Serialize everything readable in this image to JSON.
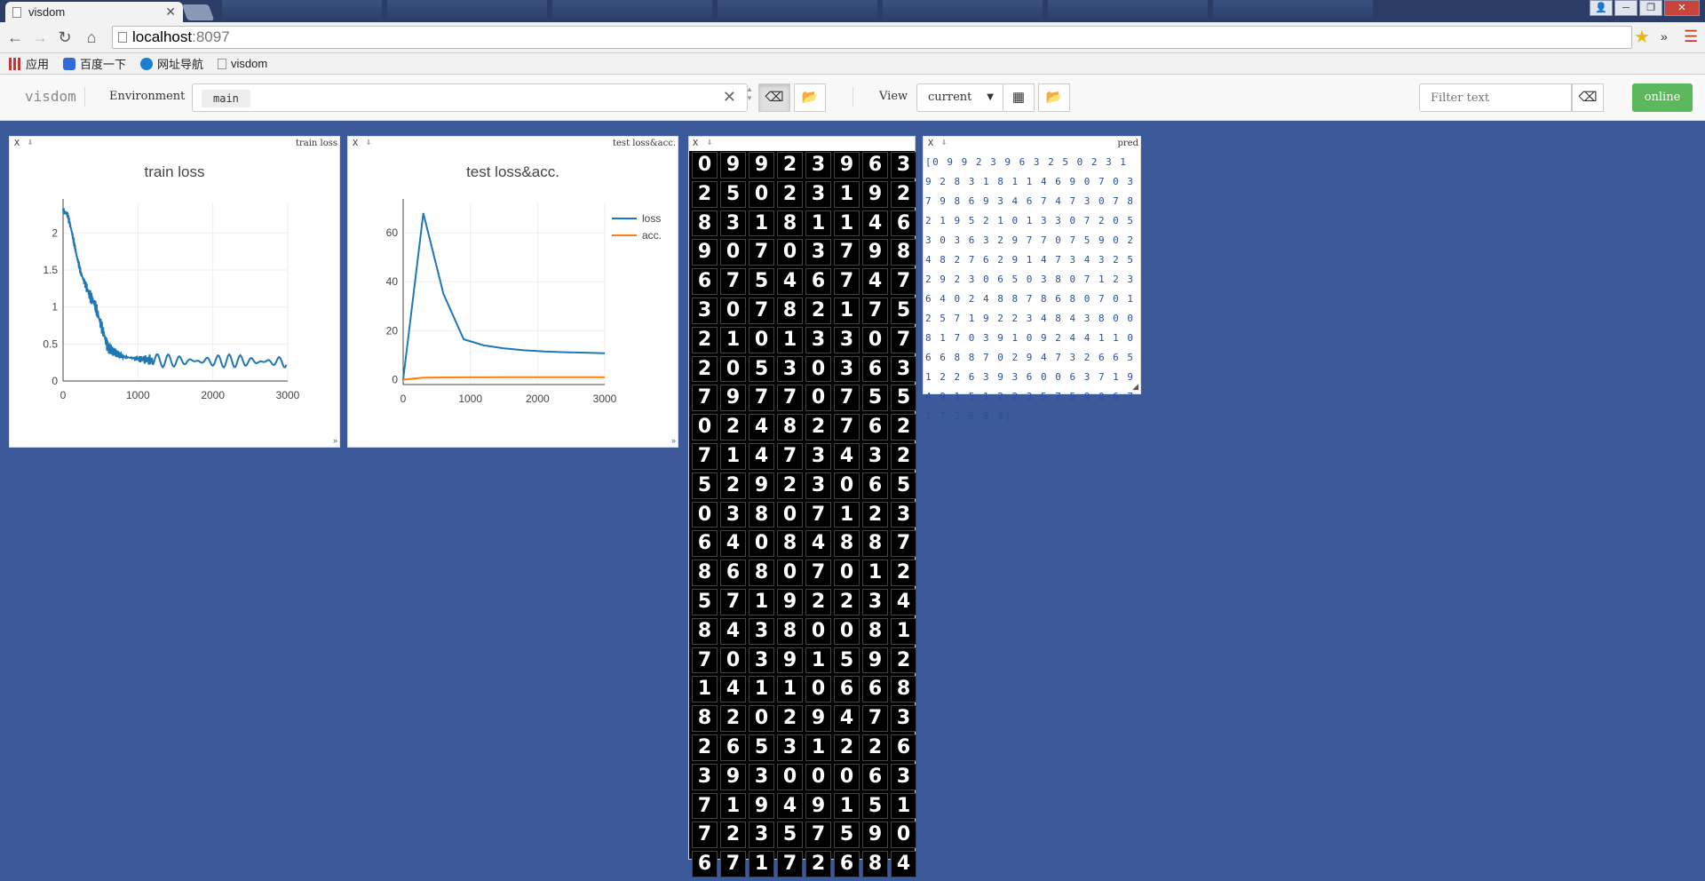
{
  "browser": {
    "tab_title": "visdom",
    "url_host": "localhost",
    "url_port": ":8097",
    "bookmarks": [
      "应用",
      "百度一下",
      "网址导航",
      "visdom"
    ]
  },
  "header": {
    "brand": "visdom",
    "env_label": "Environment",
    "env_chip": "main",
    "view_label": "View",
    "view_value": "current",
    "filter_placeholder": "Filter text",
    "online_label": "online"
  },
  "panes": {
    "train_loss": {
      "bar_title": "train loss",
      "chart_title": "train loss"
    },
    "test": {
      "bar_title": "test loss&acc.",
      "chart_title": "test loss&acc."
    },
    "pred": {
      "bar_title": "pred",
      "text": "[0 9 9 2 3 9 6 3 2 5 0 2 3 1 9 2 8 3 1 8 1 1 4 6 9 0 7 0 3 7 9 8 6 9 3 4 6 7 4 7 3 0 7 8 2 1 9 5 2 1 0 1 3 3 0 7 2 0 5 3 0 3 6 3 2 9 7 7 0 7 5 9 0 2 4 8 2 7 6 2 9 1 4 7 3 4 3 2 5 2 9 2 3 0 6 5 0 3 8 0 7 1 2 3 6 4 0 2 4 8 8 7 8 6 8 0 7 0 1 2 5 7 1 9 2 2 3 4 8 4 3 8 0 0 8 1 7 0 3 9 1 0 9 2 4 4 1 1 0 6 6 8 8 7 0 2 9 4 7 3 2 6 6 5 1 2 2 6 3 9 3 6 0 0 6 3 7 1 9 4 9 1 5 1 2 2 3 5 7 5 9 0 6 7 1 7 2 6 8 4]"
    },
    "digits_rows": [
      "09923963",
      "25023192",
      "83181146",
      "90703798",
      "67546747",
      "30782175",
      "21013307",
      "20530363",
      "79770755",
      "02482762",
      "71473432",
      "52923065",
      "03807123",
      "64084887",
      "86807012",
      "57192234",
      "84380081",
      "70391592",
      "14110668",
      "82029473",
      "26531226",
      "39300063",
      "71949151",
      "72357590",
      "67172684"
    ]
  },
  "chart_data": [
    {
      "type": "line",
      "title": "train loss",
      "xlim": [
        0,
        3000
      ],
      "ylim": [
        0,
        2.4
      ],
      "xticks": [
        0,
        1000,
        2000,
        3000
      ],
      "yticks": [
        0,
        0.5,
        1,
        1.5,
        2
      ],
      "ytick_labels": [
        "0",
        "0.5",
        "1",
        "1.5",
        "2"
      ],
      "series": [
        {
          "color": "#1f77b4",
          "x": [
            0,
            60,
            120,
            180,
            240,
            300,
            360,
            420,
            480,
            540,
            600,
            700,
            800,
            1000,
            1200,
            1500,
            1800,
            2100,
            2400,
            2700,
            3000
          ],
          "y": [
            2.3,
            2.25,
            2.0,
            1.7,
            1.45,
            1.3,
            1.15,
            1.05,
            0.85,
            0.65,
            0.45,
            0.38,
            0.33,
            0.3,
            0.28,
            0.27,
            0.27,
            0.27,
            0.27,
            0.26,
            0.26
          ]
        }
      ],
      "grid": true
    },
    {
      "type": "line",
      "title": "test loss&acc.",
      "xlim": [
        0,
        3000
      ],
      "ylim": [
        -2,
        72
      ],
      "xticks": [
        0,
        1000,
        2000,
        3000
      ],
      "yticks": [
        0,
        20,
        40,
        60
      ],
      "legend": "top-right",
      "series": [
        {
          "name": "loss",
          "color": "#1f77b4",
          "x": [
            0,
            300,
            600,
            900,
            1200,
            1500,
            1800,
            2100,
            2400,
            2700,
            3000
          ],
          "y": [
            0,
            68,
            35,
            16.5,
            14,
            12.8,
            12,
            11.5,
            11.2,
            11,
            10.8
          ]
        },
        {
          "name": "acc.",
          "color": "#ff7f0e",
          "x": [
            0,
            300,
            600,
            900,
            1200,
            1500,
            1800,
            2100,
            2400,
            2700,
            3000
          ],
          "y": [
            0,
            0.8,
            0.9,
            0.95,
            0.96,
            0.97,
            0.97,
            0.98,
            0.98,
            0.98,
            0.98
          ]
        }
      ],
      "grid": true
    }
  ]
}
